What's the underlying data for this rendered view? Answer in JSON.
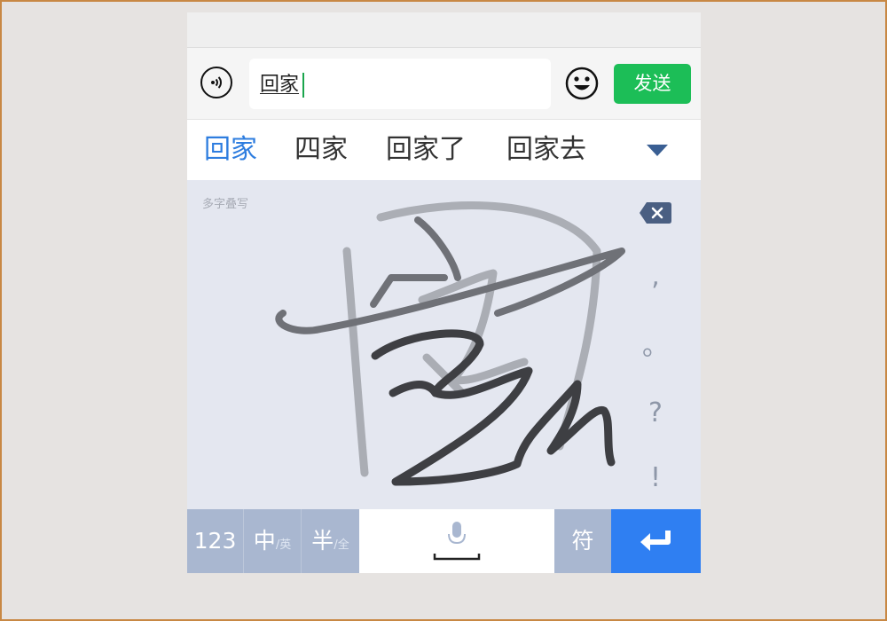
{
  "input": {
    "text": "回家",
    "send_label": "发送"
  },
  "candidates": [
    "回家",
    "四家",
    "回家了",
    "回家去"
  ],
  "handwriting": {
    "mode_label": "多字叠写"
  },
  "side_keys": [
    ",",
    "。",
    "?",
    "!"
  ],
  "bottom_keys": {
    "numeric": "123",
    "lang_main": "中",
    "lang_sub": "/英",
    "width_main": "半",
    "width_sub": "/全",
    "symbols": "符"
  },
  "icons": {
    "voice": "voice-input-icon",
    "emoji": "smiley-icon",
    "expand": "chevron-down-icon",
    "delete": "backspace-icon",
    "mic": "microphone-icon",
    "enter": "return-arrow-icon"
  },
  "colors": {
    "accent": "#2e7ddf",
    "send": "#1cbe57",
    "enter": "#2f7ff2",
    "key": "#a9b7d0",
    "hw_background": "#e4e7f0"
  }
}
